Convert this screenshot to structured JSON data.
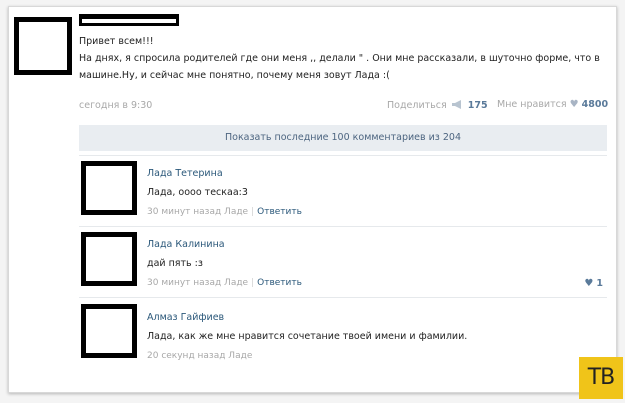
{
  "post": {
    "greeting": "Привет всем!!!",
    "line1": "На днях, я спросила родителей где они меня ,, делали \" . Они мне рассказали, в шуточно форме, что в",
    "line2": "машине.Ну, и сейчас мне понятно, почему меня зовут Лада :(",
    "time": "сегодня в 9:30",
    "share_label": "Поделиться",
    "share_count": "175",
    "like_label": "Мне нравится",
    "like_count": "4800"
  },
  "show_more": "Показать последние 100 комментариев из 204",
  "comments": [
    {
      "name": "Лада Тетерина",
      "text": "Лада, оооо тескаа:3",
      "time": "30 минут назад Ладе",
      "reply": "Ответить",
      "likes": ""
    },
    {
      "name": "Лада Калинина",
      "text": "дай пять :з",
      "time": "30 минут назад Ладе",
      "reply": "Ответить",
      "likes": "1"
    },
    {
      "name": "Алмаз Гайфиев",
      "text": "Лада, как же мне нравится сочетание твоей имени и фамилии.",
      "time": "20 секунд назад Ладе",
      "reply": "",
      "likes": ""
    }
  ],
  "watermark": "ТВ",
  "colors": {
    "link": "#2b587a",
    "muted": "#a8a8a8",
    "bar": "#e9edf1",
    "badge": "#f0c419"
  }
}
